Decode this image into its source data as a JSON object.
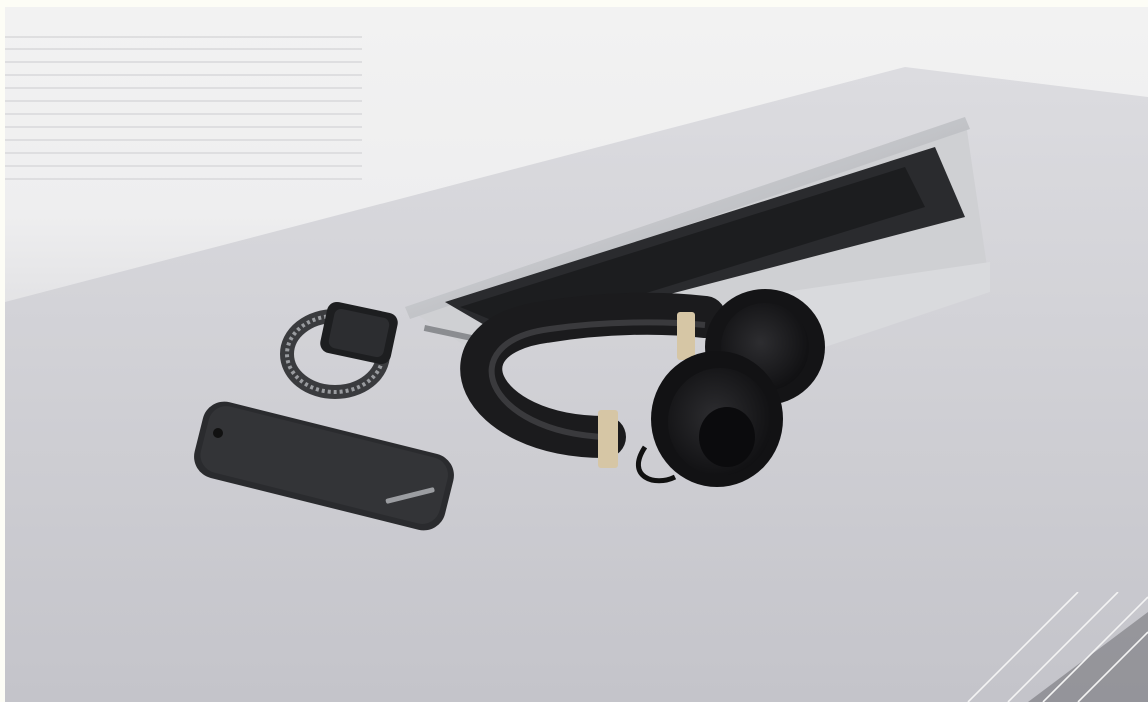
{
  "image": {
    "subject": "",
    "colors": {
      "wall": "#f2f2f2",
      "desk": "#cfcfd3",
      "device_black": "#1c1c1e",
      "laptop_silver": "#c9cacd",
      "gold_accent": "#d8c8a8"
    },
    "icons": [
      "laptop-icon",
      "headphones-icon",
      "smartwatch-icon",
      "smartphone-icon"
    ]
  }
}
